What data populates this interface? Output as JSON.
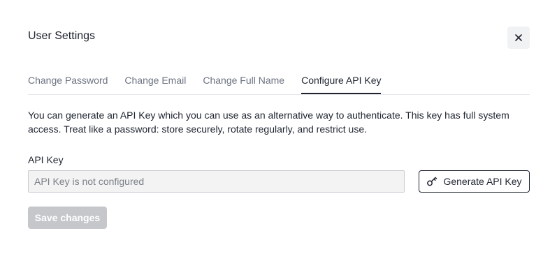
{
  "dialog": {
    "title": "User Settings",
    "close_icon": "close-icon"
  },
  "tabs": [
    {
      "label": "Change Password",
      "active": false
    },
    {
      "label": "Change Email",
      "active": false
    },
    {
      "label": "Change Full Name",
      "active": false
    },
    {
      "label": "Configure API Key",
      "active": true
    }
  ],
  "api_key": {
    "description": "You can generate an API Key which you can use as an alternative way to authenticate. This key has full system access. Treat like a password: store securely, rotate regularly, and restrict use.",
    "label": "API Key",
    "value": "",
    "placeholder": "API Key is not configured",
    "generate_button": {
      "label": "Generate API Key",
      "icon": "key-icon"
    }
  },
  "footer": {
    "save_label": "Save changes",
    "save_disabled": true
  }
}
